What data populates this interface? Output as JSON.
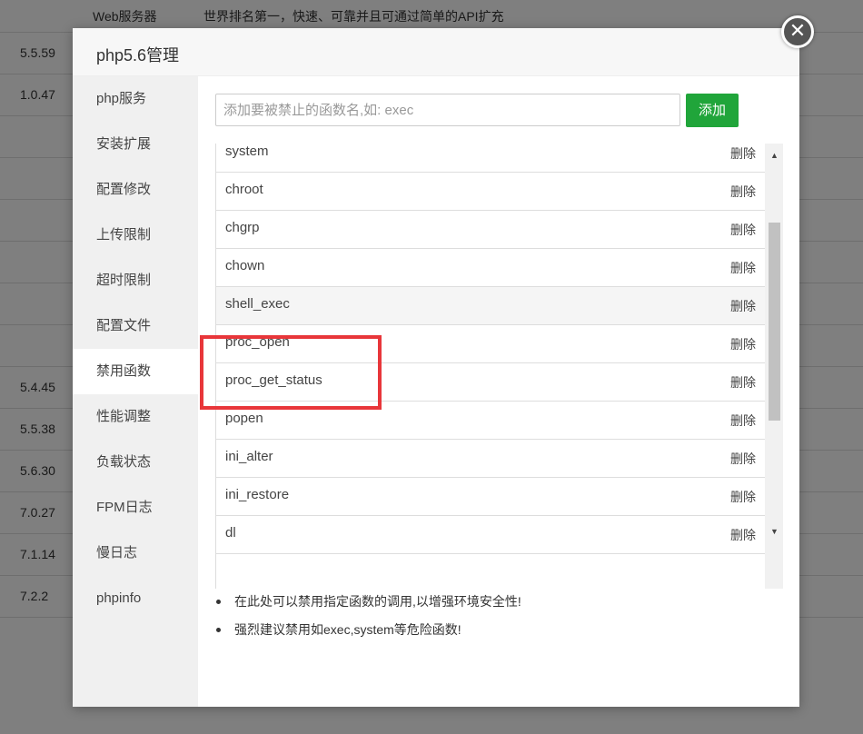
{
  "background": {
    "header_col1": "Web服务器",
    "header_col2": "世界排名第一，快速、可靠并且可通过简单的API扩充",
    "versions": [
      "5.5.59",
      "1.0.47",
      "",
      "",
      "",
      "",
      "",
      "",
      "5.4.45",
      "5.5.38",
      "5.6.30",
      "7.0.27",
      "7.1.14",
      "7.2.2"
    ]
  },
  "modal": {
    "title": "php5.6管理",
    "close_symbol": "✕"
  },
  "sidebar": {
    "items": [
      {
        "label": "php服务"
      },
      {
        "label": "安装扩展"
      },
      {
        "label": "配置修改"
      },
      {
        "label": "上传限制"
      },
      {
        "label": "超时限制"
      },
      {
        "label": "配置文件"
      },
      {
        "label": "禁用函数",
        "active": true
      },
      {
        "label": "性能调整"
      },
      {
        "label": "负载状态"
      },
      {
        "label": "FPM日志"
      },
      {
        "label": "慢日志"
      },
      {
        "label": "phpinfo"
      }
    ]
  },
  "form": {
    "input_placeholder": "添加要被禁止的函数名,如: exec",
    "input_value": "",
    "add_label": "添加"
  },
  "functions": {
    "delete_label": "删除",
    "items": [
      "system",
      "chroot",
      "chgrp",
      "chown",
      "shell_exec",
      "proc_open",
      "proc_get_status",
      "popen",
      "ini_alter",
      "ini_restore",
      "dl"
    ],
    "highlighted_row": "shell_exec",
    "boxed": [
      "proc_open",
      "proc_get_status"
    ]
  },
  "tips": [
    "在此处可以禁用指定函数的调用,以增强环境安全性!",
    "强烈建议禁用如exec,system等危险函数!"
  ],
  "colors": {
    "accent_green": "#20a53a",
    "highlight_red": "#e8363a",
    "sidebar_bg": "#f0f0f0"
  }
}
